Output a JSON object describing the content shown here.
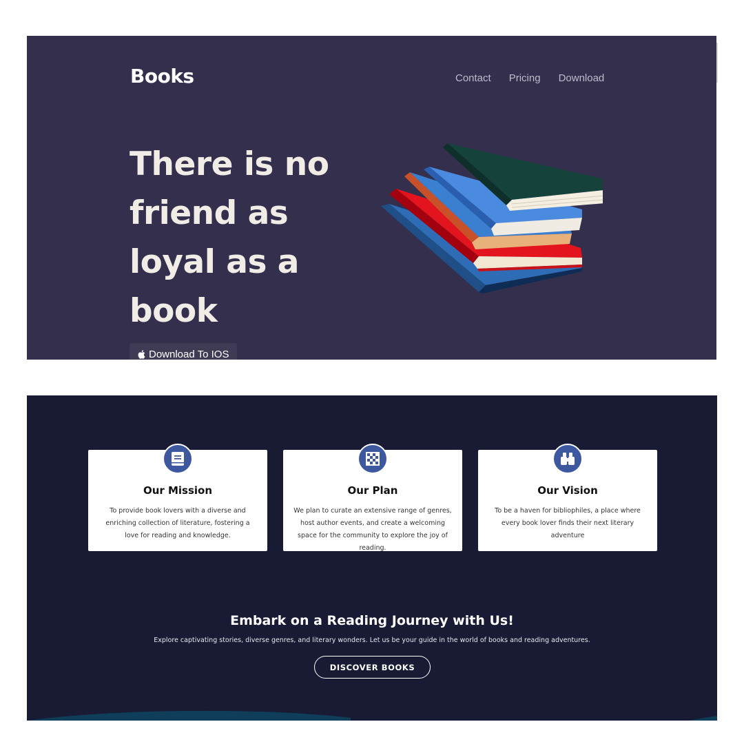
{
  "header": {
    "brand": "Books",
    "nav": [
      "Contact",
      "Pricing",
      "Download"
    ]
  },
  "hero": {
    "headline": "There is no friend as loyal as a book",
    "ios_button": "Download To IOS",
    "ios_icon": "apple-icon",
    "illustration": "stack-of-books"
  },
  "features": {
    "cards": [
      {
        "icon": "book-icon",
        "title": "Our Mission",
        "text": "To provide book lovers with a diverse and enriching collection of literature, fostering a love for reading and knowledge."
      },
      {
        "icon": "checkerboard-icon",
        "title": "Our Plan",
        "text": "We plan to curate an extensive range of genres, host author events, and create a welcoming space for the community to explore the joy of reading."
      },
      {
        "icon": "binoculars-icon",
        "title": "Our Vision",
        "text": "To be a haven for bibliophiles, a place where every book lover finds their next literary adventure"
      }
    ]
  },
  "cta": {
    "title": "Embark on a Reading Journey with Us!",
    "subtitle": "Explore captivating stories, diverse genres, and literary wonders. Let us be your guide in the world of books and reading adventures.",
    "button": "DISCOVER BOOKS"
  },
  "colors": {
    "hero_bg": "#332f4d",
    "features_bg": "#181b33",
    "icon_circle": "#3e58a0",
    "headline_text": "#f1ece6"
  }
}
